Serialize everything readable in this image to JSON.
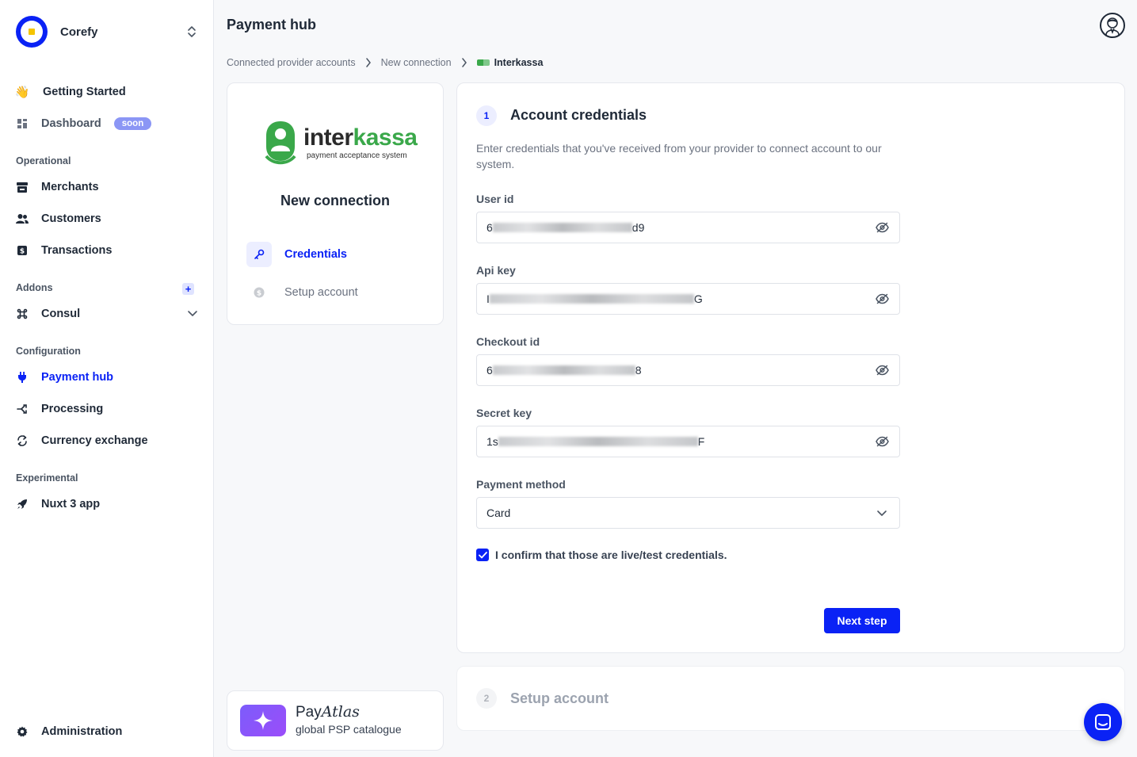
{
  "brand": {
    "name": "Corefy"
  },
  "sidebar": {
    "getting_started": "Getting Started",
    "dashboard": "Dashboard",
    "dashboard_badge": "soon",
    "sections": {
      "operational": "Operational",
      "addons": "Addons",
      "configuration": "Configuration",
      "experimental": "Experimental"
    },
    "merchants": "Merchants",
    "customers": "Customers",
    "transactions": "Transactions",
    "consul": "Consul",
    "payment_hub": "Payment hub",
    "processing": "Processing",
    "currency_exchange": "Currency exchange",
    "nuxt": "Nuxt 3 app",
    "administration": "Administration",
    "addon_plus": "+"
  },
  "header": {
    "title": "Payment hub"
  },
  "breadcrumb": {
    "items": [
      "Connected provider accounts",
      "New connection"
    ],
    "current": "Interkassa"
  },
  "provider": {
    "word_a": "inter",
    "word_b": "kassa",
    "tagline": "payment acceptance system"
  },
  "steps_card": {
    "title": "New connection",
    "steps": [
      "Credentials",
      "Setup account"
    ]
  },
  "form": {
    "step_number": "1",
    "title": "Account credentials",
    "description": "Enter credentials that you've received from your provider to connect account to our system.",
    "fields": [
      {
        "label": "User id",
        "prefix": "6",
        "suffix": "d9"
      },
      {
        "label": "Api key",
        "prefix": "I",
        "suffix": "G"
      },
      {
        "label": "Checkout id",
        "prefix": "6",
        "suffix": "8"
      },
      {
        "label": "Secret key",
        "prefix": "1s",
        "suffix": "F"
      }
    ],
    "payment_method": {
      "label": "Payment method",
      "value": "Card"
    },
    "confirm_label": "I confirm that those are live/test credentials.",
    "confirm_checked": true,
    "next_button": "Next step"
  },
  "setup": {
    "step_number": "2",
    "title": "Setup account"
  },
  "payatlas": {
    "title_a": "Pay",
    "title_b": "Atlas",
    "subtitle": "global PSP catalogue"
  },
  "colors": {
    "accent": "#0a22f5",
    "provider_green": "#3aa84a"
  }
}
